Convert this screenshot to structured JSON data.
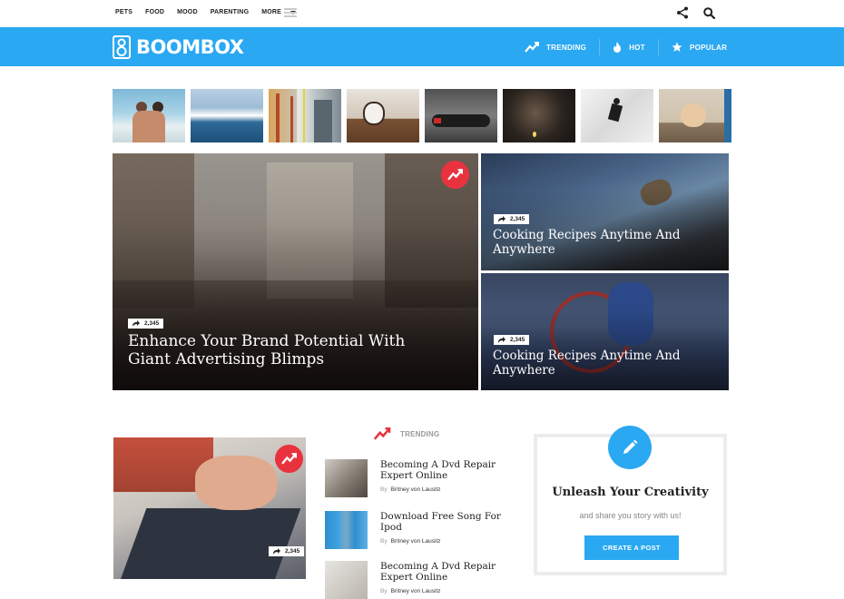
{
  "topnav": {
    "items": [
      "PETS",
      "FOOD",
      "MOOD",
      "PARENTING"
    ],
    "more_label": "MORE"
  },
  "header": {
    "logo_text": "BOOMBOX",
    "nav": [
      {
        "label": "TRENDING",
        "icon": "trending-icon"
      },
      {
        "label": "HOT",
        "icon": "flame-icon"
      },
      {
        "label": "POPULAR",
        "icon": "star-icon"
      }
    ],
    "color": "#2aa8f2"
  },
  "thumbnails": [
    {
      "icon": "thumb-beach-couple"
    },
    {
      "icon": "thumb-ocean-wave"
    },
    {
      "icon": "thumb-golden-gate-bridge"
    },
    {
      "icon": "thumb-dog"
    },
    {
      "icon": "thumb-hoverboard"
    },
    {
      "icon": "thumb-man-lighter"
    },
    {
      "icon": "thumb-runner"
    },
    {
      "icon": "thumb-puppy"
    }
  ],
  "hero": {
    "big": {
      "title": "Enhance Your Brand Potential With Giant Advertising Blimps",
      "shares": "2,345"
    },
    "small1": {
      "title": "Cooking Recipes Anytime And Anywhere",
      "shares": "2,345"
    },
    "small2": {
      "title": "Cooking Recipes Anytime And Anywhere",
      "shares": "2,345"
    }
  },
  "featured_card": {
    "shares": "2,345"
  },
  "trending": {
    "heading": "TRENDING",
    "items": [
      {
        "title": "Becoming A Dvd Repair Expert Online",
        "by": "By",
        "author": "Britney von Lausitz"
      },
      {
        "title": "Download Free Song For Ipod",
        "by": "By",
        "author": "Britney von Lausitz"
      },
      {
        "title": "Becoming A Dvd Repair Expert Online",
        "by": "By",
        "author": "Britney von Lausitz"
      }
    ]
  },
  "cta": {
    "title": "Unleash Your Creativity",
    "subtitle": "and share you story with us!",
    "button": "CREATE A POST"
  },
  "colors": {
    "accent": "#2aa8f2",
    "badge": "#e8333f"
  }
}
